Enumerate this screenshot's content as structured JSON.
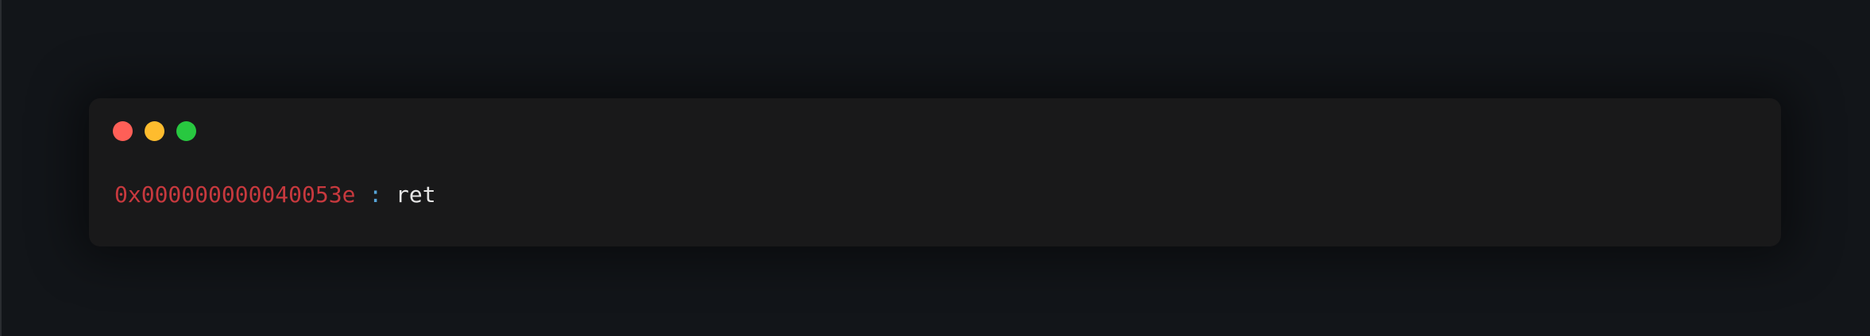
{
  "window_controls": [
    {
      "name": "close",
      "color": "#ff5f57"
    },
    {
      "name": "minimize",
      "color": "#febc2e"
    },
    {
      "name": "maximize",
      "color": "#28c840"
    }
  ],
  "code_line": {
    "address": "0x000000000040053e",
    "separator": ":",
    "instruction": "ret"
  },
  "colors": {
    "background": "#121519",
    "window": "#19191a",
    "address": "#c8393e",
    "separator": "#56a4d8",
    "instruction": "#e6e6e6"
  }
}
